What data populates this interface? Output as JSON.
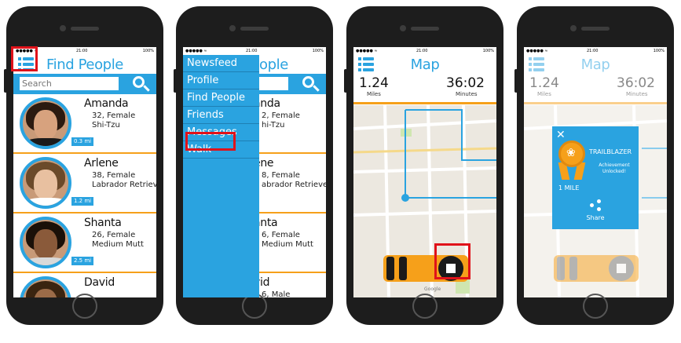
{
  "status": {
    "time": "21:00",
    "battery": "100%"
  },
  "screen1": {
    "title": "Find People",
    "search_placeholder": "Search",
    "people": [
      {
        "name": "Amanda",
        "age_gender": "32, Female",
        "breed": "Shi-Tzu",
        "distance": "0.3 mi"
      },
      {
        "name": "Arlene",
        "age_gender": "38, Female",
        "breed": "Labrador Retriever",
        "distance": "1.2 mi"
      },
      {
        "name": "Shanta",
        "age_gender": "26, Female",
        "breed": "Medium Mutt",
        "distance": "2.5 mi"
      },
      {
        "name": "David",
        "age_gender": "",
        "breed": "",
        "distance": ""
      }
    ]
  },
  "screen2": {
    "title_partial": "ople",
    "menu": [
      "Newsfeed",
      "Profile",
      "Find People",
      "Friends",
      "Messages",
      "Walk"
    ],
    "peek": [
      {
        "name": "anda",
        "age_gender": "2, Female",
        "breed": "hi-Tzu"
      },
      {
        "name": "ene",
        "age_gender": "8, Female",
        "breed": "abrador Retriever"
      },
      {
        "name": "anta",
        "age_gender": "6, Female",
        "breed": "Medium Mutt"
      },
      {
        "name": "vid",
        "age_gender": "6, Male",
        "breed": ""
      }
    ]
  },
  "screen3": {
    "title": "Map",
    "miles_value": "1.24",
    "miles_label": "Miles",
    "minutes_value": "36:02",
    "minutes_label": "Minutes"
  },
  "screen4": {
    "title": "Map",
    "miles_value": "1.24",
    "miles_label": "Miles",
    "minutes_value": "36:02",
    "minutes_label": "Minutes",
    "achievement": {
      "close": "✕",
      "title": "TRAILBLAZER",
      "subtitle": "Achievement Unlocked!",
      "distance": "1 MILE",
      "share": "Share"
    }
  },
  "colors": {
    "accent": "#2aa3e0",
    "orange": "#f6a01a",
    "highlight": "#e0121a"
  }
}
